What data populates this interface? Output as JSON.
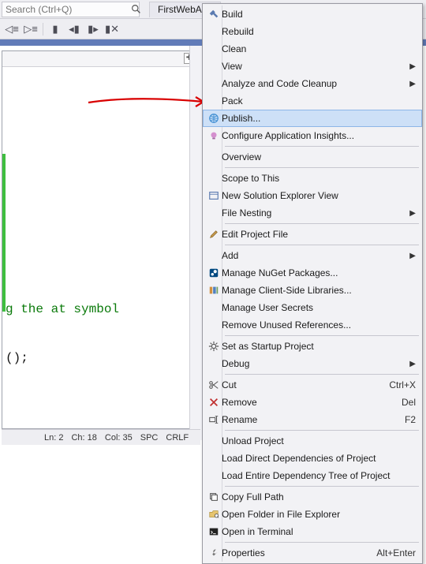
{
  "search": {
    "placeholder": "Search (Ctrl+Q)"
  },
  "tab": {
    "label": "FirstWebApp"
  },
  "editor": {
    "line1": "g the at symbol",
    "line2": "();"
  },
  "status": {
    "ln": "Ln: 2",
    "ch": "Ch: 18",
    "col": "Col: 35",
    "spc": "SPC",
    "crlf": "CRLF"
  },
  "menu": [
    {
      "t": "item",
      "icon": "hammer",
      "label": "Build"
    },
    {
      "t": "item",
      "icon": "",
      "label": "Rebuild"
    },
    {
      "t": "item",
      "icon": "",
      "label": "Clean"
    },
    {
      "t": "item",
      "icon": "",
      "label": "View",
      "sub": true
    },
    {
      "t": "item",
      "icon": "",
      "label": "Analyze and Code Cleanup",
      "sub": true
    },
    {
      "t": "item",
      "icon": "",
      "label": "Pack"
    },
    {
      "t": "item",
      "icon": "globe",
      "label": "Publish...",
      "hover": true
    },
    {
      "t": "item",
      "icon": "bulb",
      "label": "Configure Application Insights..."
    },
    {
      "t": "sep"
    },
    {
      "t": "item",
      "icon": "",
      "label": "Overview"
    },
    {
      "t": "sep"
    },
    {
      "t": "item",
      "icon": "",
      "label": "Scope to This"
    },
    {
      "t": "item",
      "icon": "window",
      "label": "New Solution Explorer View"
    },
    {
      "t": "item",
      "icon": "",
      "label": "File Nesting",
      "sub": true
    },
    {
      "t": "sep"
    },
    {
      "t": "item",
      "icon": "pencil",
      "label": "Edit Project File"
    },
    {
      "t": "sep"
    },
    {
      "t": "item",
      "icon": "",
      "label": "Add",
      "sub": true
    },
    {
      "t": "item",
      "icon": "nuget",
      "label": "Manage NuGet Packages..."
    },
    {
      "t": "item",
      "icon": "lib",
      "label": "Manage Client-Side Libraries..."
    },
    {
      "t": "item",
      "icon": "",
      "label": "Manage User Secrets"
    },
    {
      "t": "item",
      "icon": "",
      "label": "Remove Unused References..."
    },
    {
      "t": "sep"
    },
    {
      "t": "item",
      "icon": "gear",
      "label": "Set as Startup Project"
    },
    {
      "t": "item",
      "icon": "",
      "label": "Debug",
      "sub": true
    },
    {
      "t": "sep"
    },
    {
      "t": "item",
      "icon": "scissors",
      "label": "Cut",
      "key": "Ctrl+X"
    },
    {
      "t": "item",
      "icon": "x",
      "label": "Remove",
      "key": "Del"
    },
    {
      "t": "item",
      "icon": "rename",
      "label": "Rename",
      "key": "F2"
    },
    {
      "t": "sep"
    },
    {
      "t": "item",
      "icon": "",
      "label": "Unload Project"
    },
    {
      "t": "item",
      "icon": "",
      "label": "Load Direct Dependencies of Project"
    },
    {
      "t": "item",
      "icon": "",
      "label": "Load Entire Dependency Tree of Project"
    },
    {
      "t": "sep"
    },
    {
      "t": "item",
      "icon": "copy",
      "label": "Copy Full Path"
    },
    {
      "t": "item",
      "icon": "folder",
      "label": "Open Folder in File Explorer"
    },
    {
      "t": "item",
      "icon": "terminal",
      "label": "Open in Terminal"
    },
    {
      "t": "sep"
    },
    {
      "t": "item",
      "icon": "wrench",
      "label": "Properties",
      "key": "Alt+Enter"
    }
  ]
}
